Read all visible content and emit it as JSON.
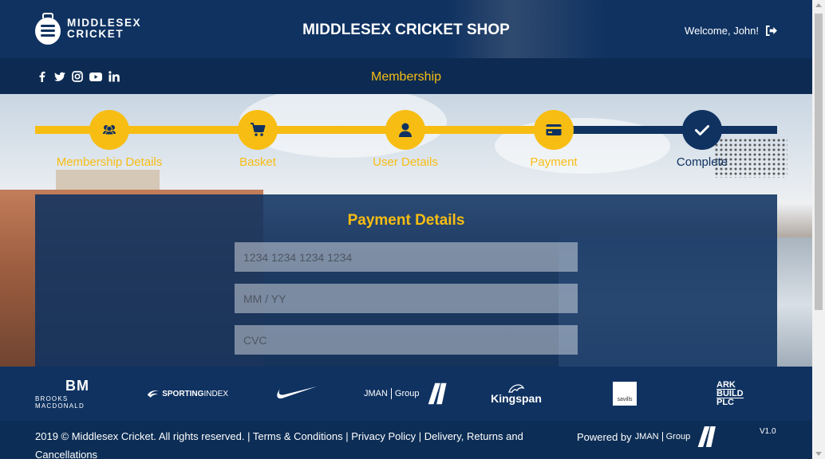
{
  "header": {
    "logo_line1": "MIDDLESEX",
    "logo_line2": "CRICKET",
    "title": "MIDDLESEX CRICKET SHOP",
    "welcome": "Welcome, John!",
    "signout_icon": "sign-out-icon"
  },
  "nav": {
    "social_icons": [
      "facebook-icon",
      "twitter-icon",
      "instagram-icon",
      "youtube-icon",
      "linkedin-icon"
    ],
    "title": "Membership"
  },
  "steps": [
    {
      "label": "Membership Details",
      "icon": "users-icon",
      "state": "done"
    },
    {
      "label": "Basket",
      "icon": "cart-icon",
      "state": "done"
    },
    {
      "label": "User Details",
      "icon": "user-icon",
      "state": "done"
    },
    {
      "label": "Payment",
      "icon": "credit-card-icon",
      "state": "done"
    },
    {
      "label": "Complete",
      "icon": "check-icon",
      "state": "current"
    }
  ],
  "form": {
    "title": "Payment Details",
    "card_number_placeholder": "1234 1234 1234 1234",
    "card_number_value": "",
    "expiry_placeholder": "MM / YY",
    "expiry_value": "",
    "cvc_placeholder": "CVC",
    "cvc_value": ""
  },
  "sponsors": {
    "brooks_mark": "BM",
    "brooks_name": "BROOKS MACDONALD",
    "sporting_a": "SPORTING",
    "sporting_b": "INDEX",
    "nike": "nike-swoosh-logo",
    "jman_a": "JMAN",
    "jman_b": "Group",
    "kingspan": "Kingspan",
    "savills": "savills",
    "ark_1": "ARK",
    "ark_2": "BUILD",
    "ark_3": "PLC"
  },
  "footer": {
    "copyright": "2019 © Middlesex Cricket. All rights reserved.",
    "links": [
      "Terms & Conditions",
      "Privacy Policy",
      "Delivery, Returns and Cancellations"
    ],
    "separator": "|",
    "powered_by": "Powered by",
    "powered_brand_a": "JMAN",
    "powered_brand_b": "Group",
    "version": "V1.0"
  },
  "colors": {
    "navy": "#0f3261",
    "yellow": "#f7bd13"
  }
}
